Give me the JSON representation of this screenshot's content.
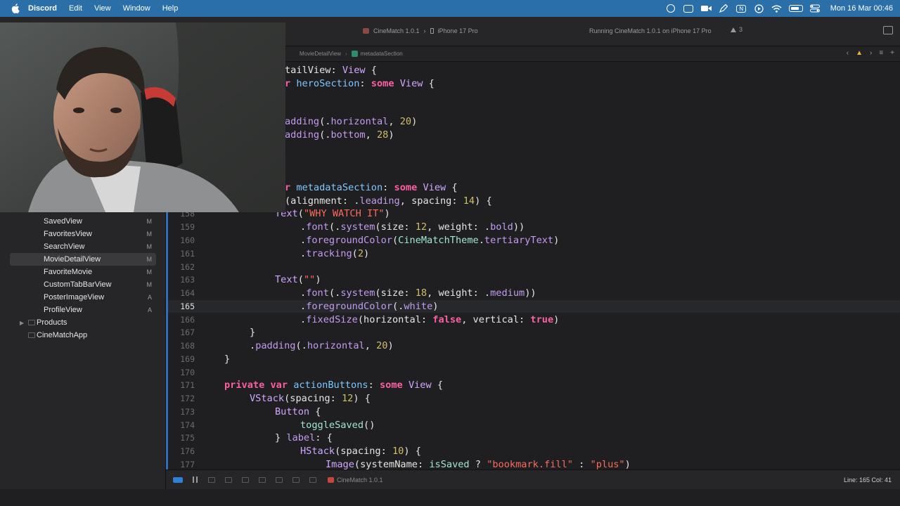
{
  "menubar": {
    "app_name": "Discord",
    "items": [
      "Edit",
      "View",
      "Window",
      "Help"
    ],
    "clock": "Mon 16 Mar  00:46",
    "status_icons": [
      "screen-mirror-icon",
      "display-icon",
      "facetime-icon",
      "pen-icon",
      "notion-icon",
      "play-icon",
      "wifi-icon",
      "battery-icon",
      "control-center-icon"
    ]
  },
  "toolbar": {
    "scheme": "CineMatch 1.0.1",
    "device": "iPhone 17 Pro",
    "run_status": "Running CineMatch 1.0.1 on iPhone 17 Pro",
    "warning_count": "3"
  },
  "jumpbar": {
    "file": "MovieDetailView",
    "symbol": "metadataSection",
    "warning_icon": "warning-icon"
  },
  "navigator": {
    "files": [
      {
        "label": "SavedView",
        "badge": "M"
      },
      {
        "label": "FavoritesView",
        "badge": "M"
      },
      {
        "label": "SearchView",
        "badge": "M"
      },
      {
        "label": "MovieDetailView",
        "badge": "M"
      },
      {
        "label": "FavoriteMovie",
        "badge": "M"
      },
      {
        "label": "CustomTabBarView",
        "badge": "M"
      },
      {
        "label": "PosterImageView",
        "badge": "A"
      },
      {
        "label": "ProfileView",
        "badge": "A"
      }
    ],
    "groups": [
      {
        "label": "Products"
      },
      {
        "label": "CineMatchApp"
      }
    ]
  },
  "editor": {
    "current_line": "165"
  },
  "debugbar": {
    "app": "CineMatch 1.0.1",
    "position": "Line: 165  Col: 41"
  },
  "colors": {
    "menubar": "#2b6fa8",
    "keyword": "#fc5fa3",
    "string": "#fc6a5d",
    "number": "#d0bf69",
    "type": "#d0a8ff",
    "selection_accent": "#2f6fb8"
  }
}
